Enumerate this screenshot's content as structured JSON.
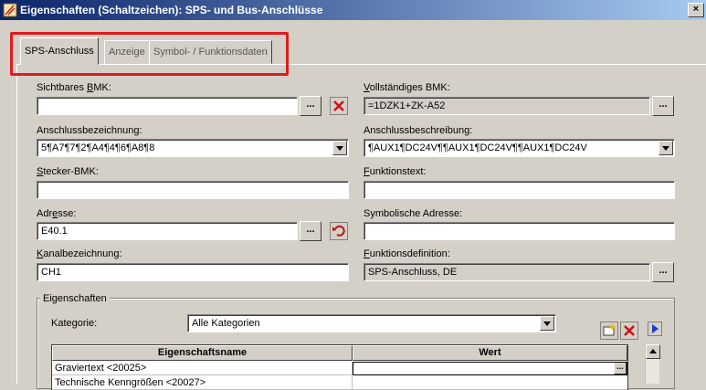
{
  "window": {
    "title": "Eigenschaften (Schaltzeichen): SPS- und Bus-Anschlüsse",
    "close_label": "×"
  },
  "tabs": [
    {
      "label": "SPS-Anschluss",
      "active": true
    },
    {
      "label": "Anzeige",
      "active": false
    },
    {
      "label": "Symbol- / Funktionsdaten",
      "active": false
    }
  ],
  "form": {
    "sichtbares_bmk": {
      "label_pre": "Sichtbares ",
      "label_u": "B",
      "label_post": "MK:",
      "value": ""
    },
    "vollstaendiges_bmk": {
      "label_pre": "",
      "label_u": "V",
      "label_post": "ollständiges BMK:",
      "value": "=1DZK1+ZK-A52"
    },
    "anschlussbezeichnung": {
      "label_pre": "Anschlussbezeichnung:",
      "label_u": "",
      "label_post": "",
      "value": "5¶A7¶7¶2¶A4¶4¶6¶A8¶8"
    },
    "anschlussbeschreibung": {
      "label_pre": "Anschlussbeschreibung:",
      "label_u": "",
      "label_post": "",
      "value": "¶AUX1¶DC24V¶¶AUX1¶DC24V¶¶AUX1¶DC24V"
    },
    "stecker_bmk": {
      "label_pre": "",
      "label_u": "S",
      "label_post": "tecker-BMK:",
      "value": ""
    },
    "funktionstext": {
      "label_pre": "",
      "label_u": "F",
      "label_post": "unktionstext:",
      "value": ""
    },
    "adresse": {
      "label_pre": "Adr",
      "label_u": "e",
      "label_post": "sse:",
      "value": "E40.1"
    },
    "symbolische_adresse": {
      "label_pre": "Symbolische Adresse:",
      "label_u": "",
      "label_post": "",
      "value": ""
    },
    "kanalbezeichnung": {
      "label_pre": "",
      "label_u": "K",
      "label_post": "analbezeichnung:",
      "value": "CH1"
    },
    "funktionsdefinition": {
      "label_pre": "",
      "label_u": "F",
      "label_post": "unktionsdefinition:",
      "value": "SPS-Anschluss, DE"
    },
    "browse_label": "..."
  },
  "properties": {
    "group_title": "Eigenschaften",
    "kategorie_label": "Kategorie:",
    "kategorie_value": "Alle Kategorien",
    "columns": [
      "Eigenschaftsname",
      "Wert"
    ],
    "rows": [
      {
        "name": "Graviertext <20025>",
        "value": ""
      },
      {
        "name": "Technische Kenngrößen <20027>",
        "value": ""
      }
    ]
  },
  "colors": {
    "highlight": "#e11a1a",
    "title_start": "#0a246a",
    "title_end": "#a6caf0"
  }
}
